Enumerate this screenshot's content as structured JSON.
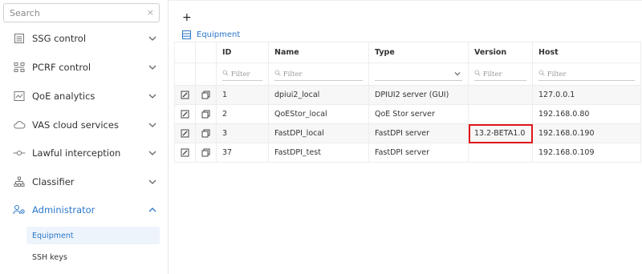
{
  "sidebar": {
    "search_placeholder": "Search",
    "search_clear": "×",
    "items": [
      {
        "label": "SSG control",
        "icon": "server-icon"
      },
      {
        "label": "PCRF control",
        "icon": "network-icon"
      },
      {
        "label": "QoE analytics",
        "icon": "chart-icon"
      },
      {
        "label": "VAS cloud services",
        "icon": "cloud-icon"
      },
      {
        "label": "Lawful interception",
        "icon": "intercept-icon"
      },
      {
        "label": "Classifier",
        "icon": "hierarchy-icon"
      },
      {
        "label": "Administrator",
        "icon": "users-gear-icon"
      }
    ],
    "subitems": [
      {
        "label": "Equipment"
      },
      {
        "label": "SSH keys"
      }
    ]
  },
  "main": {
    "add_label": "+",
    "section_title": "Equipment",
    "columns": [
      "ID",
      "Name",
      "Type",
      "Version",
      "Host"
    ],
    "filter_placeholder": "Filter",
    "rows": [
      {
        "id": "1",
        "name": "dpiui2_local",
        "type": "DPIUI2 server (GUI)",
        "version": "",
        "host": "127.0.0.1"
      },
      {
        "id": "2",
        "name": "QoEStor_local",
        "type": "QoE Stor server",
        "version": "",
        "host": "192.168.0.80"
      },
      {
        "id": "3",
        "name": "FastDPI_local",
        "type": "FastDPI server",
        "version": "13.2-BETA1.0",
        "host": "192.168.0.190"
      },
      {
        "id": "37",
        "name": "FastDPI_test",
        "type": "FastDPI server",
        "version": "",
        "host": "192.168.0.109"
      }
    ]
  },
  "colors": {
    "accent": "#2a78c8",
    "highlight": "#e0161b"
  }
}
